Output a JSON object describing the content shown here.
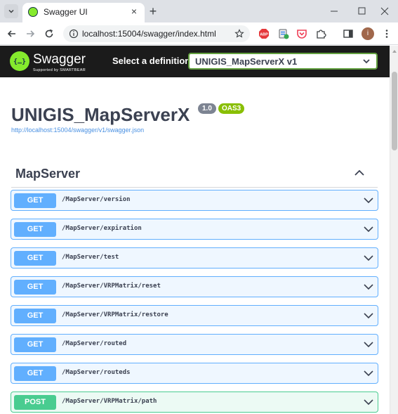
{
  "browser": {
    "tab_title": "Swagger UI",
    "url": "localhost:15004/swagger/index.html"
  },
  "swagger": {
    "logo_text": "Swagger",
    "logo_sub": "Supported by SMARTBEAR",
    "select_label": "Select a definition",
    "selected_definition": "UNIGIS_MapServerX v1",
    "title": "UNIGIS_MapServerX",
    "version": "1.0",
    "oas_badge": "OAS3",
    "spec_url": "http://localhost:15004/swagger/v1/swagger.json",
    "tag": "MapServer",
    "operations": [
      {
        "method": "GET",
        "path": "/MapServer/version"
      },
      {
        "method": "GET",
        "path": "/MapServer/expiration"
      },
      {
        "method": "GET",
        "path": "/MapServer/test"
      },
      {
        "method": "GET",
        "path": "/MapServer/VRPMatrix/reset"
      },
      {
        "method": "GET",
        "path": "/MapServer/VRPMatrix/restore"
      },
      {
        "method": "GET",
        "path": "/MapServer/routed"
      },
      {
        "method": "GET",
        "path": "/MapServer/routeds"
      },
      {
        "method": "POST",
        "path": "/MapServer/VRPMatrix/path"
      }
    ]
  },
  "colors": {
    "get": "#61affe",
    "post": "#49cc90",
    "swagger_green": "#85ea2d",
    "topbar": "#1b1b1b"
  }
}
